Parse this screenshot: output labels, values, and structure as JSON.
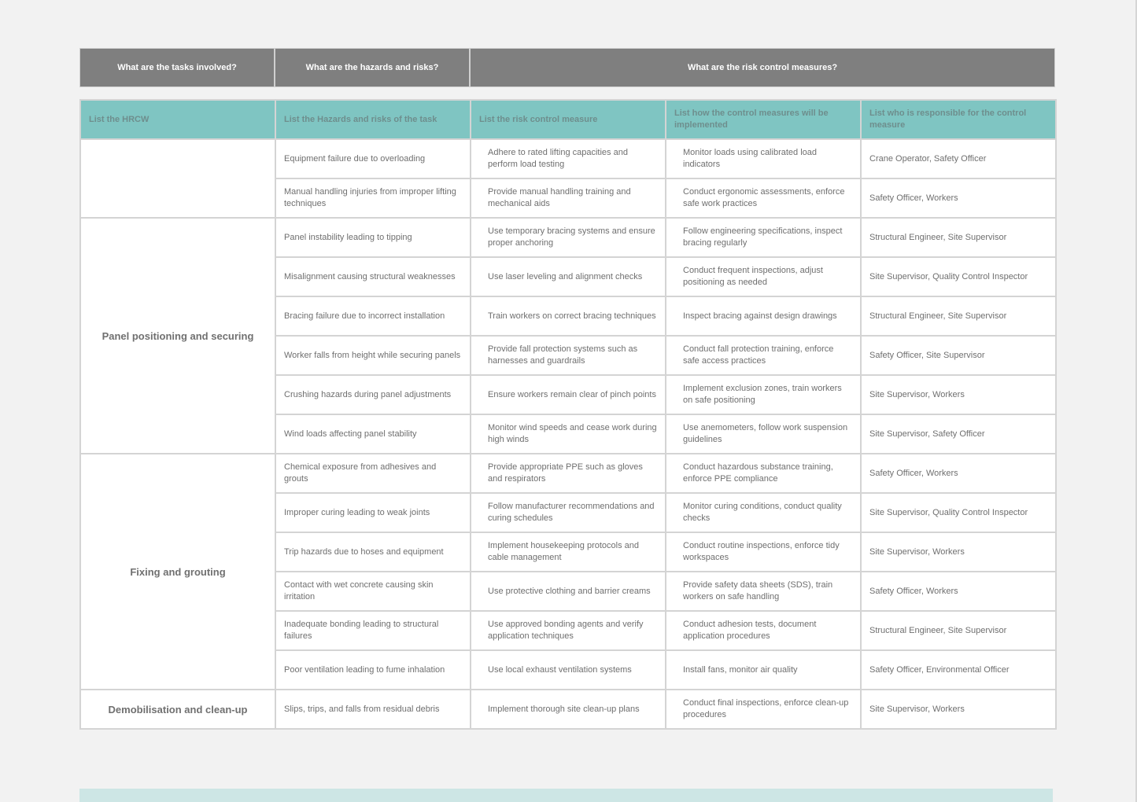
{
  "top_headers": {
    "tasks": "What are the tasks involved?",
    "hazards": "What are the hazards and risks?",
    "controls": "What are the risk control measures?"
  },
  "sub_headers": {
    "hrcw": "List the HRCW",
    "hazards": "List the Hazards and risks of the task",
    "measure": "List the risk control measure",
    "implementation": "List how the control measures will be implemented",
    "responsible": "List who is responsible for the control measure"
  },
  "groups": [
    {
      "task": "",
      "rows": [
        {
          "hazard": "Equipment failure due to overloading",
          "measure": "Adhere to rated lifting capacities and perform load testing",
          "implementation": "Monitor loads using calibrated load indicators",
          "responsible": "Crane Operator, Safety Officer"
        },
        {
          "hazard": "Manual handling injuries from improper lifting techniques",
          "measure": "Provide manual handling training and mechanical aids",
          "implementation": "Conduct ergonomic assessments, enforce safe work practices",
          "responsible": "Safety Officer, Workers"
        }
      ]
    },
    {
      "task": "Panel positioning and securing",
      "rows": [
        {
          "hazard": "Panel instability leading to tipping",
          "measure": "Use temporary bracing systems and ensure proper anchoring",
          "implementation": "Follow engineering specifications, inspect bracing regularly",
          "responsible": "Structural Engineer, Site Supervisor"
        },
        {
          "hazard": "Misalignment causing structural weaknesses",
          "measure": "Use laser leveling and alignment checks",
          "implementation": "Conduct frequent inspections, adjust positioning as needed",
          "responsible": "Site Supervisor, Quality Control Inspector"
        },
        {
          "hazard": "Bracing failure due to incorrect installation",
          "measure": "Train workers on correct bracing techniques",
          "implementation": "Inspect bracing against design drawings",
          "responsible": "Structural Engineer, Site Supervisor"
        },
        {
          "hazard": "Worker falls from height while securing panels",
          "measure": "Provide fall protection systems such as harnesses and guardrails",
          "implementation": "Conduct fall protection training, enforce safe access practices",
          "responsible": "Safety Officer, Site Supervisor"
        },
        {
          "hazard": "Crushing hazards during panel adjustments",
          "measure": "Ensure workers remain clear of pinch points",
          "implementation": "Implement exclusion zones, train workers on safe positioning",
          "responsible": "Site Supervisor, Workers"
        },
        {
          "hazard": "Wind loads affecting panel stability",
          "measure": "Monitor wind speeds and cease work during high winds",
          "implementation": "Use anemometers, follow work suspension guidelines",
          "responsible": "Site Supervisor, Safety Officer"
        }
      ]
    },
    {
      "task": "Fixing and grouting",
      "rows": [
        {
          "hazard": "Chemical exposure from adhesives and grouts",
          "measure": "Provide appropriate PPE such as gloves and respirators",
          "implementation": "Conduct hazardous substance training, enforce PPE compliance",
          "responsible": "Safety Officer, Workers"
        },
        {
          "hazard": "Improper curing leading to weak joints",
          "measure": "Follow manufacturer recommendations and curing schedules",
          "implementation": "Monitor curing conditions, conduct quality checks",
          "responsible": "Site Supervisor, Quality Control Inspector"
        },
        {
          "hazard": "Trip hazards due to hoses and equipment",
          "measure": "Implement housekeeping protocols and cable management",
          "implementation": "Conduct routine inspections, enforce tidy workspaces",
          "responsible": "Site Supervisor, Workers"
        },
        {
          "hazard": "Contact with wet concrete causing skin irritation",
          "measure": "Use protective clothing and barrier creams",
          "implementation": "Provide safety data sheets (SDS), train workers on safe handling",
          "responsible": "Safety Officer, Workers"
        },
        {
          "hazard": "Inadequate bonding leading to structural failures",
          "measure": "Use approved bonding agents and verify application techniques",
          "implementation": "Conduct adhesion tests, document application procedures",
          "responsible": "Structural Engineer, Site Supervisor"
        },
        {
          "hazard": "Poor ventilation leading to fume inhalation",
          "measure": "Use local exhaust ventilation systems",
          "implementation": "Install fans, monitor air quality",
          "responsible": "Safety Officer, Environmental Officer"
        }
      ]
    },
    {
      "task": "Demobilisation and clean-up",
      "rows": [
        {
          "hazard": "Slips, trips, and falls from residual debris",
          "measure": "Implement thorough site clean-up plans",
          "implementation": "Conduct final inspections, enforce clean-up procedures",
          "responsible": "Site Supervisor, Workers"
        }
      ]
    }
  ],
  "colors": {
    "top_header_bg": "#7f7f7f",
    "sub_header_bg": "#7fc5c2",
    "page_bg": "#f2f2f2",
    "footer_band": "#cde6e5"
  }
}
